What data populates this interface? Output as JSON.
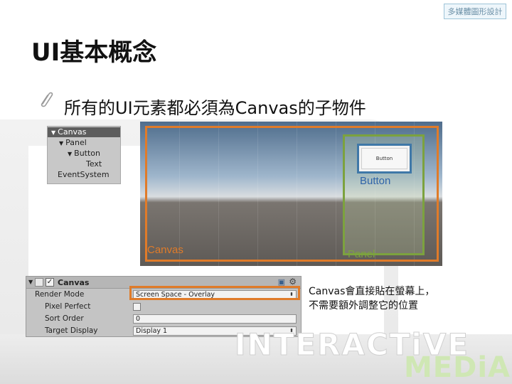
{
  "slide": {
    "logo_text": "多媒體圖形設計",
    "title": "UI基本概念",
    "bullet": "所有的UI元素都必須為Canvas的子物件",
    "note_line1": "Canvas會直接貼在螢幕上，",
    "note_line2": "不需要額外調整它的位置",
    "watermark_line1": "INTERACTiVE",
    "watermark_line2": "MEDiA"
  },
  "hierarchy": {
    "items": [
      {
        "label": "Canvas",
        "indent": 0,
        "expanded": true,
        "selected": true
      },
      {
        "label": "Panel",
        "indent": 1,
        "expanded": true,
        "selected": false
      },
      {
        "label": "Button",
        "indent": 2,
        "expanded": true,
        "selected": false
      },
      {
        "label": "Text",
        "indent": 3,
        "expanded": false,
        "selected": false
      },
      {
        "label": "EventSystem",
        "indent": 0,
        "expanded": false,
        "selected": false
      }
    ]
  },
  "scene": {
    "button_text": "Button",
    "label_button": "Button",
    "label_canvas": "Canvas",
    "label_panel": "Panel",
    "colors": {
      "canvas": "#e07b29",
      "panel": "#7ca23e",
      "button": "#3f78a8"
    }
  },
  "inspector": {
    "component_name": "Canvas",
    "enabled": true,
    "render_mode_label": "Render Mode",
    "render_mode_value": "Screen Space - Overlay",
    "pixel_perfect_label": "Pixel Perfect",
    "pixel_perfect": false,
    "sort_order_label": "Sort Order",
    "sort_order_value": "0",
    "target_display_label": "Target Display",
    "target_display_value": "Display 1"
  }
}
